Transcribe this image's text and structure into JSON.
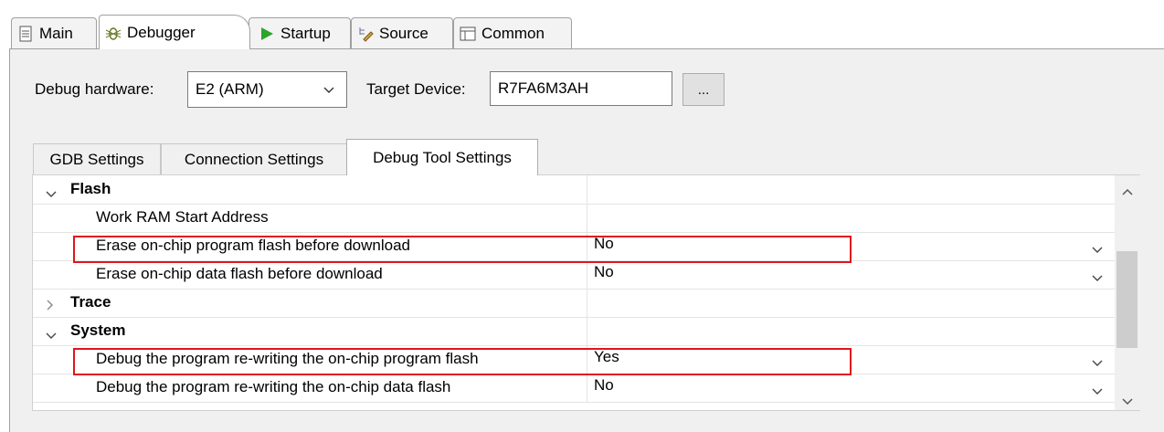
{
  "tabs": [
    {
      "label": "Main",
      "icon": "document-icon"
    },
    {
      "label": "Debugger",
      "icon": "bug-icon"
    },
    {
      "label": "Startup",
      "icon": "play-icon"
    },
    {
      "label": "Source",
      "icon": "source-lookup-icon"
    },
    {
      "label": "Common",
      "icon": "common-table-icon"
    }
  ],
  "debug_hardware": {
    "label": "Debug hardware:",
    "value": "E2 (ARM)"
  },
  "target_device": {
    "label": "Target Device:",
    "value": "R7FA6M3AH",
    "browse_label": "..."
  },
  "inner_tabs": [
    "GDB Settings",
    "Connection Settings",
    "Debug Tool Settings"
  ],
  "tree": {
    "flash": {
      "label": "Flash",
      "items": [
        {
          "label": "Work RAM Start Address",
          "value": ""
        },
        {
          "label": "Erase on-chip program flash before download",
          "value": "No"
        },
        {
          "label": "Erase on-chip data flash before download",
          "value": "No"
        }
      ]
    },
    "trace": {
      "label": "Trace"
    },
    "system": {
      "label": "System",
      "items": [
        {
          "label": "Debug the program re-writing the on-chip program flash",
          "value": "Yes"
        },
        {
          "label": "Debug the program re-writing the on-chip data flash",
          "value": "No"
        }
      ]
    }
  },
  "colors": {
    "highlight": "#e0161b",
    "accent_play": "#2aa52a"
  }
}
